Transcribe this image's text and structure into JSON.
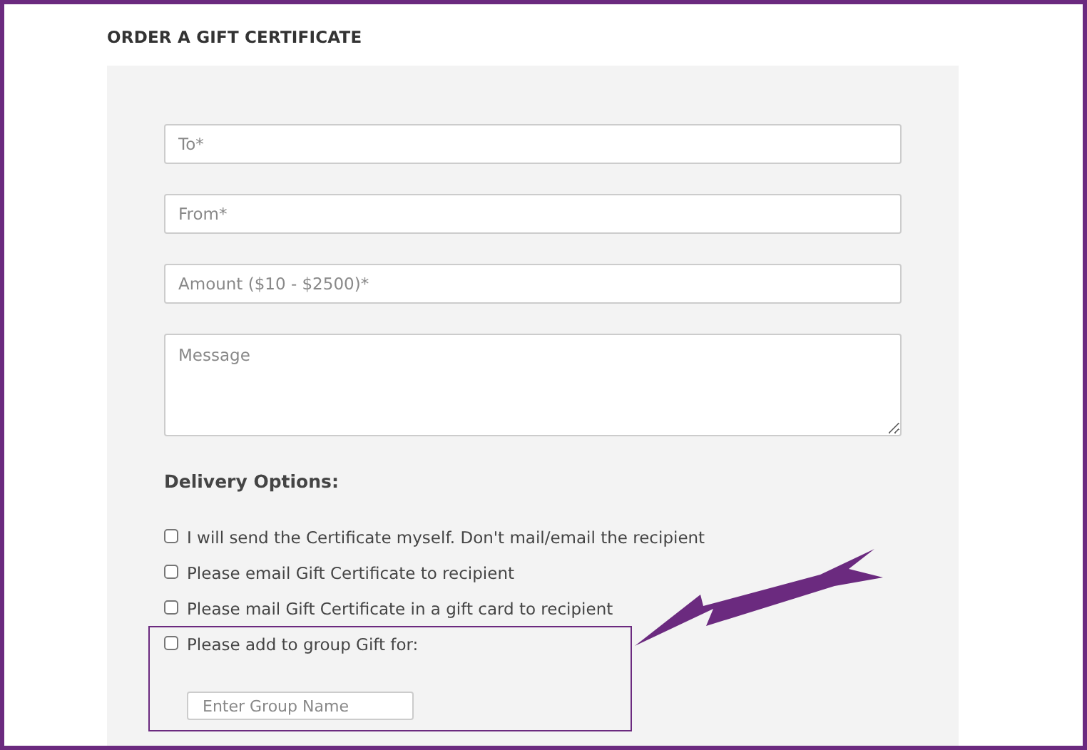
{
  "title": "ORDER A GIFT CERTIFICATE",
  "fields": [
    {
      "kind": "input",
      "placeholder": "To*"
    },
    {
      "kind": "input",
      "placeholder": "From*"
    },
    {
      "kind": "input",
      "placeholder": "Amount ($10 - $2500)*"
    },
    {
      "kind": "textarea",
      "placeholder": "Message"
    }
  ],
  "delivery": {
    "heading": "Delivery Options:",
    "options": [
      {
        "label": "I will send the Certificate myself. Don't mail/email the recipient",
        "checked": false,
        "highlighted": false
      },
      {
        "label": "Please email Gift Certificate to recipient",
        "checked": false,
        "highlighted": false
      },
      {
        "label": "Please mail Gift Certificate in a gift card to recipient",
        "checked": false,
        "highlighted": false
      },
      {
        "label": "Please add to group Gift for:",
        "checked": false,
        "highlighted": true,
        "group_field": {
          "placeholder": "Enter Group Name"
        }
      }
    ]
  }
}
